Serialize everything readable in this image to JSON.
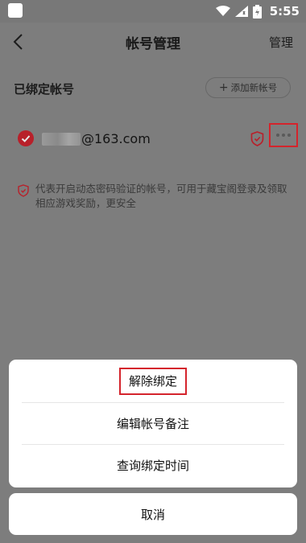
{
  "status_bar": {
    "time": "5:55"
  },
  "nav": {
    "title": "帐号管理",
    "manage_label": "管理"
  },
  "bound_section": {
    "title": "已绑定帐号",
    "add_button_label": "添加新帐号",
    "account": {
      "email_suffix": "@163.com"
    }
  },
  "notice": {
    "text": "代表开启动态密码验证的帐号，可用于藏宝阁登录及领取相应游戏奖励，更安全"
  },
  "action_sheet": {
    "items": [
      "解除绑定",
      "编辑帐号备注",
      "查询绑定时间"
    ],
    "cancel_label": "取消"
  },
  "colors": {
    "accent_red": "#d4242c",
    "check_red": "#b8202a",
    "overlay_gray": "#7d7d7d"
  }
}
